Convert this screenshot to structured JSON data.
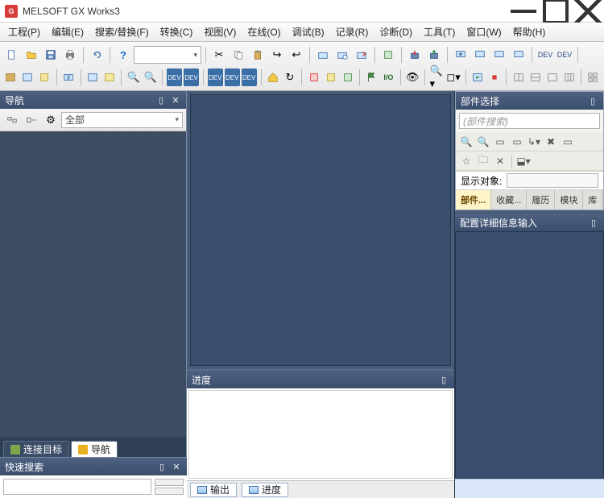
{
  "title": "MELSOFT GX Works3",
  "menus": [
    "工程(P)",
    "编辑(E)",
    "搜索/替换(F)",
    "转换(C)",
    "视图(V)",
    "在线(O)",
    "调试(B)",
    "记录(R)",
    "诊断(D)",
    "工具(T)",
    "窗口(W)",
    "帮助(H)"
  ],
  "nav": {
    "title": "导航",
    "filter_label": "全部",
    "tabs": [
      {
        "icon": "green",
        "label": "连接目标"
      },
      {
        "icon": "yellow",
        "label": "导航"
      }
    ]
  },
  "parts": {
    "title": "部件选择",
    "search_placeholder": "(部件搜索)",
    "display_label": "显示对象:",
    "tabs": [
      "部件...",
      "收藏...",
      "履历",
      "模块",
      "库"
    ]
  },
  "config": {
    "title": "配置详细信息输入"
  },
  "progress": {
    "title": "进度"
  },
  "bottom_tabs": [
    "输出",
    "进度"
  ],
  "quicksearch": {
    "title": "快速搜索"
  }
}
